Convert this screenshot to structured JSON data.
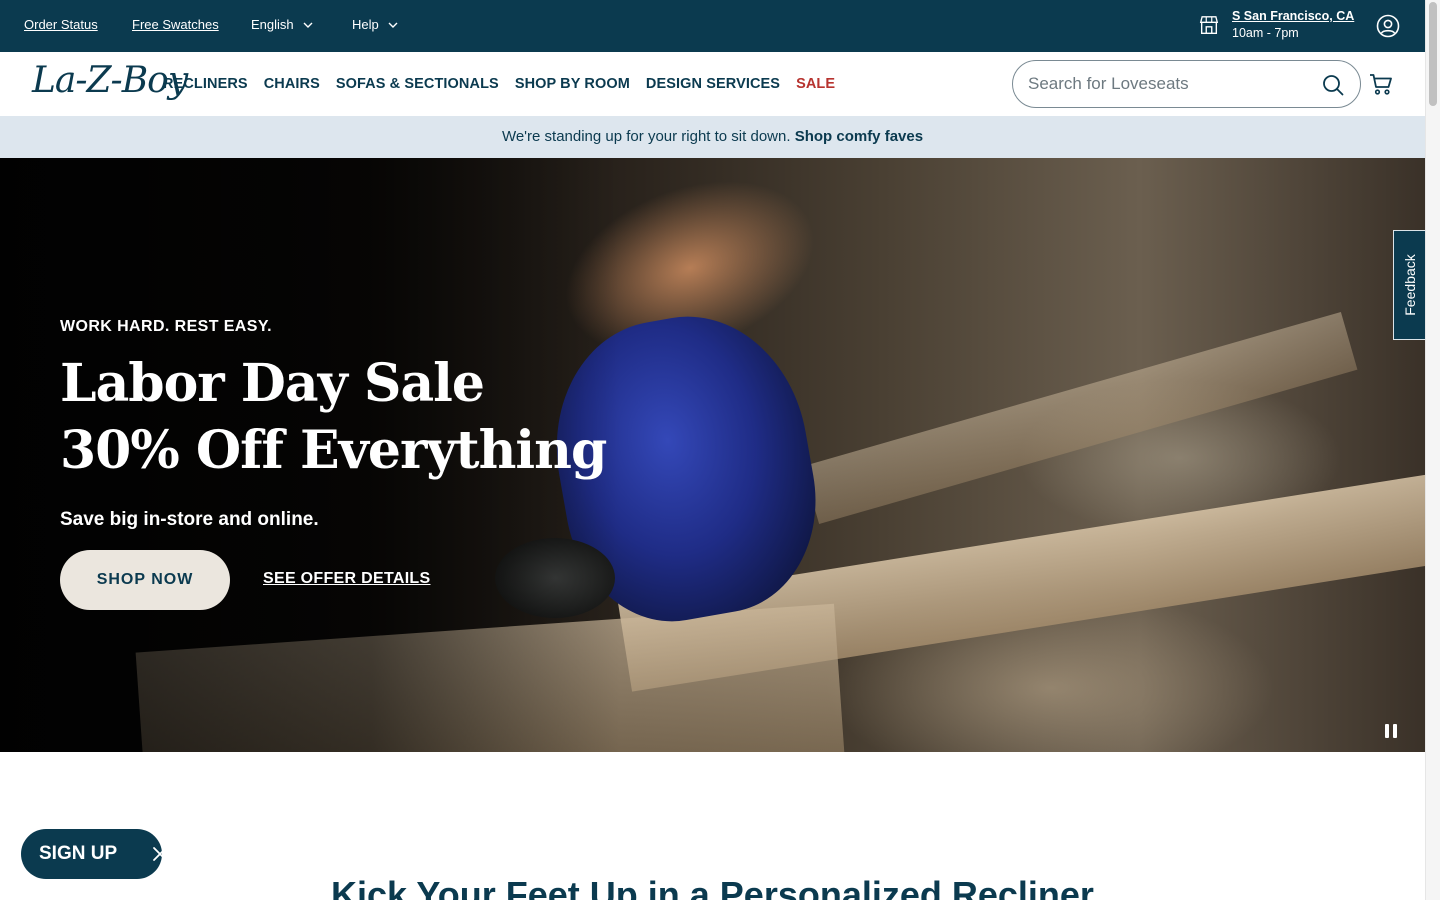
{
  "utility_bar": {
    "order_status": "Order Status",
    "free_swatches": "Free Swatches",
    "language": "English",
    "help": "Help",
    "store": {
      "name": "S San Francisco, CA",
      "hours": "10am - 7pm"
    }
  },
  "header": {
    "logo": "La-Z-Boy",
    "nav": [
      "RECLINERS",
      "CHAIRS",
      "SOFAS & SECTIONALS",
      "SHOP BY ROOM",
      "DESIGN SERVICES",
      "SALE"
    ],
    "search": {
      "placeholder": "Search for Loveseats",
      "value": ""
    }
  },
  "promo": {
    "text": "We're standing up for your right to sit down.",
    "link": "Shop comfy faves"
  },
  "hero": {
    "kicker": "WORK HARD. REST EASY.",
    "title_line1": "Labor Day Sale",
    "title_line2": "30% Off Everything",
    "subtitle": "Save big in-store and online.",
    "cta_primary": "SHOP NOW",
    "cta_secondary": "SEE OFFER DETAILS"
  },
  "feedback": "Feedback",
  "section": {
    "title": "Kick Your Feet Up in a Personalized Recliner"
  },
  "signup": {
    "label": "SIGN UP"
  },
  "colors": {
    "brand_navy": "#0b3a4f",
    "sale_red": "#b7332f",
    "promo_bg": "#dde6ee",
    "button_cream": "#ebe6de"
  },
  "icons": [
    "chevron-down-icon",
    "store-icon",
    "account-icon",
    "search-icon",
    "cart-icon",
    "pause-icon",
    "close-icon"
  ]
}
